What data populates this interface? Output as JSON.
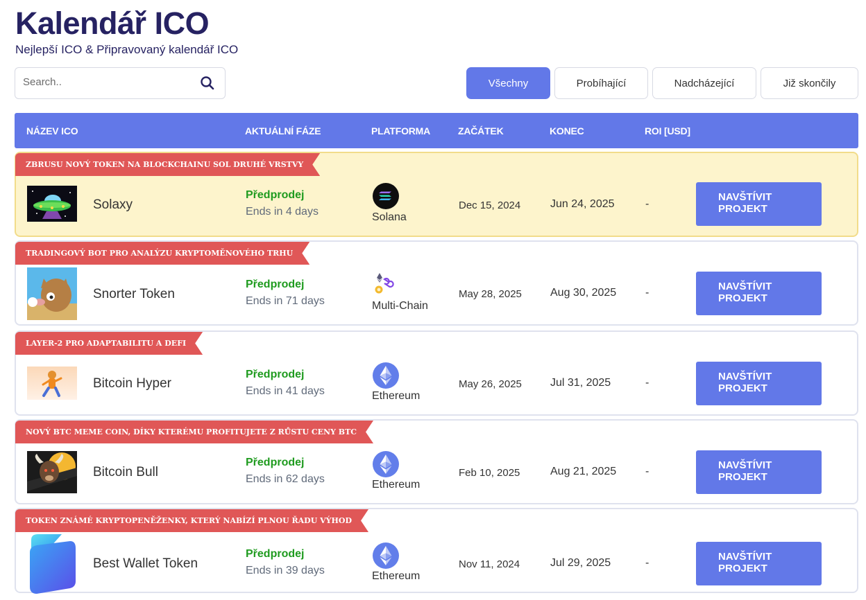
{
  "header": {
    "title": "Kalendář ICO",
    "subtitle": "Nejlepší ICO & Připravovaný kalendář ICO"
  },
  "search": {
    "placeholder": "Search.."
  },
  "filters": [
    "Všechny",
    "Probíhající",
    "Nadcházející",
    "Již skončily"
  ],
  "table": {
    "columns": [
      "NÁZEV ICO",
      "AKTUÁLNÍ FÁZE",
      "PLATFORMA",
      "ZAČÁTEK",
      "KONEC",
      "ROI [USD]"
    ],
    "rows": [
      {
        "ribbon": "ZBRUSU NOVÝ TOKEN NA BLOCKCHAINU SOL DRUHÉ VRSTVY",
        "name": "Solaxy",
        "phase": "Předprodej",
        "ends": "Ends in 4 days",
        "platform": "Solana",
        "start": "Dec 15, 2024",
        "end": "Jun 24, 2025",
        "roi": "-",
        "button": "NAVŠTÍVIT\nPROJEKT",
        "platform_icon": "solana-icon",
        "logo": "ufo-logo"
      },
      {
        "ribbon": "TRADINGOVÝ BOT PRO ANALÝZU KRYPTOMĚNOVÉHO TRHU",
        "name": "Snorter Token",
        "phase": "Předprodej",
        "ends": "Ends in 71 days",
        "platform": "Multi-Chain",
        "start": "May 28, 2025",
        "end": "Aug 30, 2025",
        "roi": "-",
        "button": "NAVŠTÍVIT\nPROJEKT",
        "platform_icon": "multichain-icon",
        "logo": "snorter-logo"
      },
      {
        "ribbon": "LAYER-2 PRO ADAPTABILITU A DEFI",
        "name": "Bitcoin Hyper",
        "phase": "Předprodej",
        "ends": "Ends in 41 days",
        "platform": "Ethereum",
        "start": "May 26, 2025",
        "end": "Jul 31, 2025",
        "roi": "-",
        "button": "NAVŠTÍVIT\nPROJEKT",
        "platform_icon": "ethereum-icon",
        "logo": "bitcoin-hyper-logo"
      },
      {
        "ribbon": "NOVÝ BTC MEME COIN, DÍKY KTERÉMU PROFITUJETE Z RŮSTU CENY BTC",
        "name": "Bitcoin Bull",
        "phase": "Předprodej",
        "ends": "Ends in 62 days",
        "platform": "Ethereum",
        "start": "Feb 10, 2025",
        "end": "Aug 21, 2025",
        "roi": "-",
        "button": "NAVŠTÍVIT\nPROJEKT",
        "platform_icon": "ethereum-icon",
        "logo": "bull-logo"
      },
      {
        "ribbon": "TOKEN ZNÁMÉ KRYPTOPENĚŽENKY, KTERÝ NABÍZÍ PLNOU ŘADU VÝHOD",
        "name": "Best Wallet Token",
        "phase": "Předprodej",
        "ends": "Ends in 39 days",
        "platform": "Ethereum",
        "start": "Nov 11, 2024",
        "end": "Jul 29, 2025",
        "roi": "-",
        "button": "NAVŠTÍVIT\nPROJEKT",
        "platform_icon": "ethereum-icon",
        "logo": "best-wallet-logo"
      }
    ]
  },
  "colors": {
    "accent": "#6278e8",
    "title": "#262262",
    "ribbon": "#e05757",
    "phase": "#1f9b1f",
    "featured_bg": "#fdf4cc"
  }
}
